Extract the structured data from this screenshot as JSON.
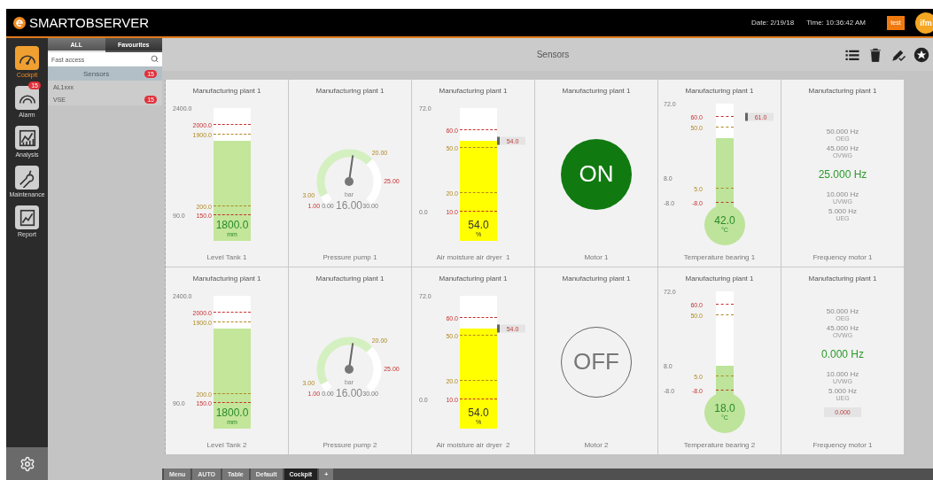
{
  "header": {
    "brand": "SMARTOBSERVER",
    "date": "Date: 2/19/18",
    "time": "Time: 10:36:42 AM",
    "user_button": "test",
    "logo": "ifm"
  },
  "nav": [
    {
      "label": "Cockpit",
      "selected": true
    },
    {
      "label": "Alarm",
      "selected": false,
      "badge": "15"
    },
    {
      "label": "Analysis",
      "selected": false
    },
    {
      "label": "Maintenance",
      "selected": false
    },
    {
      "label": "Report",
      "selected": false
    }
  ],
  "sidebar": {
    "tabs": [
      {
        "label": "ALL",
        "selected": true
      },
      {
        "label": "Favourites",
        "selected": false
      }
    ],
    "search": {
      "placeholder": "Fast access"
    },
    "group": {
      "label": "Sensors",
      "badge": "15"
    },
    "items": [
      {
        "label": "AL1xxx"
      },
      {
        "label": "VSE",
        "badge": "15"
      }
    ]
  },
  "toolbar": {
    "title": "Sensors"
  },
  "cards": [
    {
      "kind": "level",
      "plant": "Manufacturing plant 1",
      "name": "Level Tank 1",
      "value": "1800.0",
      "unit": "mm",
      "level": 0.75,
      "color": "#c3e69a",
      "marks": [
        {
          "label": "2400.0",
          "kind": "scale"
        },
        {
          "label": "2000.0",
          "kind": "alarm"
        },
        {
          "label": "1900.0",
          "kind": "warning"
        },
        {
          "label": "200.0",
          "kind": "warning"
        },
        {
          "label": "90.0",
          "kind": "scale"
        },
        {
          "label": "150.0",
          "kind": "alarm"
        }
      ]
    },
    {
      "kind": "gauge",
      "plant": "Manufacturing plant 1",
      "name": "Pressure pump 1",
      "value": "16.00",
      "unit": "bar",
      "labels": [
        {
          "label": "20.00",
          "kind": "warning"
        },
        {
          "label": "25.00",
          "kind": "alarm"
        },
        {
          "label": "3.00",
          "kind": "warning"
        },
        {
          "label": "1.00",
          "kind": "alarm"
        },
        {
          "label": "0.00",
          "kind": "scale"
        },
        {
          "label": "30.00",
          "kind": "scale"
        }
      ]
    },
    {
      "kind": "level",
      "plant": "Manufacturing plant 1",
      "name": "Air moisture air dryer  1",
      "value": "54.0",
      "unit": "%",
      "level": 0.75,
      "color": "#ffff00",
      "tag": "54.0",
      "marks": [
        {
          "label": "72.0",
          "kind": "scale"
        },
        {
          "label": "60.0",
          "kind": "alarm"
        },
        {
          "label": "50.0",
          "kind": "warning"
        },
        {
          "label": "20.0",
          "kind": "warning"
        },
        {
          "label": "0.0",
          "kind": "scale"
        },
        {
          "label": "10.0",
          "kind": "alarm"
        }
      ]
    },
    {
      "kind": "switch",
      "plant": "Manufacturing plant 1",
      "name": "Motor 1",
      "on": true,
      "value": "ON"
    },
    {
      "kind": "thermometer",
      "plant": "Manufacturing plant 1",
      "name": "Temperature bearing 1",
      "value": "42.0",
      "unit": "°C",
      "level": 0.67,
      "tag": "61.0",
      "marks": [
        {
          "label": "72.0",
          "kind": "scale"
        },
        {
          "label": "60.0",
          "kind": "alarm"
        },
        {
          "label": "50.0",
          "kind": "warning"
        },
        {
          "label": "8.0",
          "kind": "scale"
        },
        {
          "label": "5.0",
          "kind": "warning"
        },
        {
          "label": "-8.0",
          "kind": "scale"
        },
        {
          "label": "-8.0",
          "kind": "alarm"
        }
      ]
    },
    {
      "kind": "frequency",
      "plant": "Manufacturing plant 1",
      "name": "Frequency motor 1",
      "value": "25.000 Hz",
      "upper": [
        {
          "value": "50.000 Hz",
          "label": "OEG"
        },
        {
          "value": "45.000 Hz",
          "label": "OVWG"
        }
      ],
      "lower": [
        {
          "value": "10.000 Hz",
          "label": "UVWG"
        },
        {
          "value": "5.000 Hz",
          "label": "UEG"
        }
      ]
    },
    {
      "kind": "level",
      "plant": "Manufacturing plant 1",
      "name": "Level Tank 2",
      "value": "1800.0",
      "unit": "mm",
      "level": 0.75,
      "color": "#c3e69a",
      "marks": [
        {
          "label": "2400.0",
          "kind": "scale"
        },
        {
          "label": "2000.0",
          "kind": "alarm"
        },
        {
          "label": "1900.0",
          "kind": "warning"
        },
        {
          "label": "200.0",
          "kind": "warning"
        },
        {
          "label": "90.0",
          "kind": "scale"
        },
        {
          "label": "150.0",
          "kind": "alarm"
        }
      ]
    },
    {
      "kind": "gauge",
      "plant": "Manufacturing plant 1",
      "name": "Pressure pump 2",
      "value": "16.00",
      "unit": "bar",
      "labels": [
        {
          "label": "20.00",
          "kind": "warning"
        },
        {
          "label": "25.00",
          "kind": "alarm"
        },
        {
          "label": "3.00",
          "kind": "warning"
        },
        {
          "label": "1.00",
          "kind": "alarm"
        },
        {
          "label": "0.00",
          "kind": "scale"
        },
        {
          "label": "30.00",
          "kind": "scale"
        }
      ]
    },
    {
      "kind": "level",
      "plant": "Manufacturing plant 1",
      "name": "Air moisture air dryer  2",
      "value": "54.0",
      "unit": "%",
      "level": 0.75,
      "color": "#ffff00",
      "tag": "54.0",
      "marks": [
        {
          "label": "72.0",
          "kind": "scale"
        },
        {
          "label": "60.0",
          "kind": "alarm"
        },
        {
          "label": "50.0",
          "kind": "warning"
        },
        {
          "label": "20.0",
          "kind": "warning"
        },
        {
          "label": "0.0",
          "kind": "scale"
        },
        {
          "label": "10.0",
          "kind": "alarm"
        }
      ]
    },
    {
      "kind": "switch",
      "plant": "Manufacturing plant 1",
      "name": "Motor 2",
      "on": false,
      "value": "OFF"
    },
    {
      "kind": "thermometer",
      "plant": "Manufacturing plant 1",
      "name": "Temperature bearing 2",
      "value": "18.0",
      "unit": "°C",
      "level": 0.3,
      "marks": [
        {
          "label": "72.0",
          "kind": "scale"
        },
        {
          "label": "60.0",
          "kind": "alarm"
        },
        {
          "label": "50.0",
          "kind": "warning"
        },
        {
          "label": "8.0",
          "kind": "scale"
        },
        {
          "label": "5.0",
          "kind": "warning"
        },
        {
          "label": "-8.0",
          "kind": "scale"
        },
        {
          "label": "-8.0",
          "kind": "alarm"
        }
      ]
    },
    {
      "kind": "frequency",
      "plant": "Manufacturing plant 1",
      "name": "Frequency motor 1",
      "value": "0.000 Hz",
      "upper": [
        {
          "value": "50.000 Hz",
          "label": "OEG"
        },
        {
          "value": "45.000 Hz",
          "label": "OVWG"
        }
      ],
      "lower": [
        {
          "value": "10.000 Hz",
          "label": "UVWG"
        },
        {
          "value": "5.000 Hz",
          "label": "UEG"
        }
      ],
      "entry": "0.000"
    }
  ],
  "bottom_tabs": [
    {
      "label": "Menu",
      "selected": false
    },
    {
      "label": "AUTO",
      "selected": false
    },
    {
      "label": "Table",
      "selected": false
    },
    {
      "label": "Default",
      "selected": false
    },
    {
      "label": "Cockpit",
      "selected": true
    },
    {
      "label": "+",
      "selected": false
    }
  ]
}
